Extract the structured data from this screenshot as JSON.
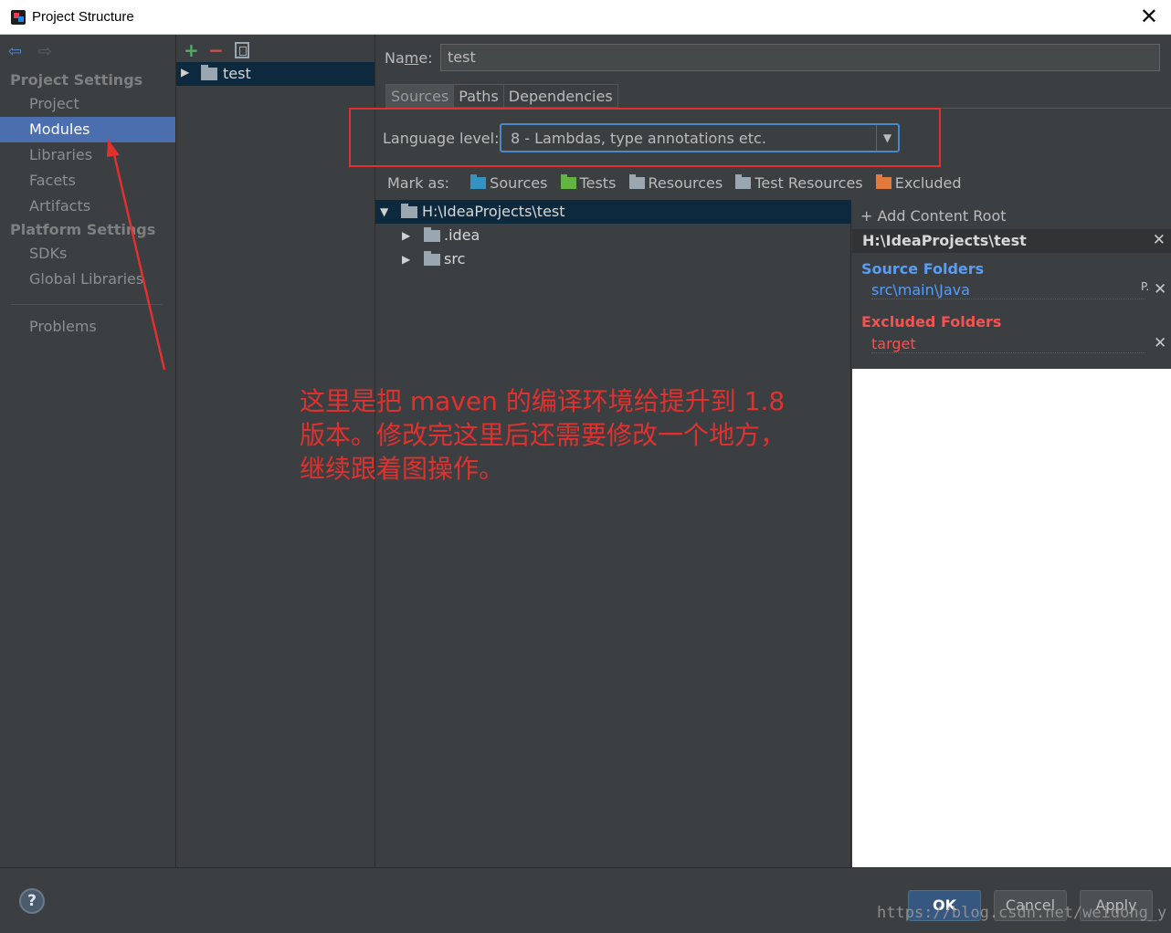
{
  "window": {
    "title": "Project Structure",
    "close_glyph": "✕"
  },
  "sidebar": {
    "nav_back": "⇦",
    "nav_forward": "⇨",
    "project_settings_title": "Project Settings",
    "platform_settings_title": "Platform Settings",
    "items": [
      {
        "label": "Project"
      },
      {
        "label": "Modules",
        "selected": true
      },
      {
        "label": "Libraries"
      },
      {
        "label": "Facets"
      },
      {
        "label": "Artifacts"
      },
      {
        "label": "SDKs"
      },
      {
        "label": "Global Libraries"
      },
      {
        "label": "Problems"
      }
    ]
  },
  "modules": {
    "add_glyph": "+",
    "remove_glyph": "−",
    "list": [
      {
        "name": "test"
      }
    ]
  },
  "main": {
    "name_label_pre": "Na",
    "name_label_u": "m",
    "name_label_post": "e:",
    "name_value": "test",
    "tabs": [
      {
        "label": "Sources",
        "active": true
      },
      {
        "label": "Paths"
      },
      {
        "label": "Dependencies"
      }
    ],
    "language_level_label": "Language level:",
    "language_level_value": "8 - Lambdas, type annotations etc.",
    "mark_as_label": "Mark as:",
    "mark_as": [
      {
        "label": "Sources",
        "color": "#3592c4"
      },
      {
        "label": "Tests",
        "color": "#62b543"
      },
      {
        "label": "Resources",
        "color": "#9aa7b0"
      },
      {
        "label": "Test Resources",
        "color": "#9aa7b0"
      },
      {
        "label": "Excluded",
        "color": "#e2793d"
      }
    ],
    "tree": [
      {
        "label": "H:\\IdeaProjects\\test",
        "expanded": true
      },
      {
        "label": ".idea"
      },
      {
        "label": "src"
      }
    ],
    "add_content_root": "+ Add Content Root",
    "content_root_path": "H:\\IdeaProjects\\test",
    "source_folders_title": "Source Folders",
    "source_folders_color": "#589df6",
    "source_folder_item": "src\\main\\Java",
    "excluded_folders_title": "Excluded Folders",
    "excluded_folders_color": "#f55252",
    "excluded_folder_item": "target"
  },
  "annotation": {
    "color": "#e0312f",
    "line1_a": "这里是把 ",
    "line1_b": "maven",
    "line1_c": " 的编译环境给提升到 ",
    "line1_d": "1.8",
    "line2": "版本。修改完这里后还需要修改一个地方，",
    "line3": "继续跟着图操作。"
  },
  "footer": {
    "help": "?",
    "ok": "OK",
    "cancel": "Cancel",
    "apply": "Apply",
    "watermark": "https://blog.csdn.net/weidong_y"
  }
}
